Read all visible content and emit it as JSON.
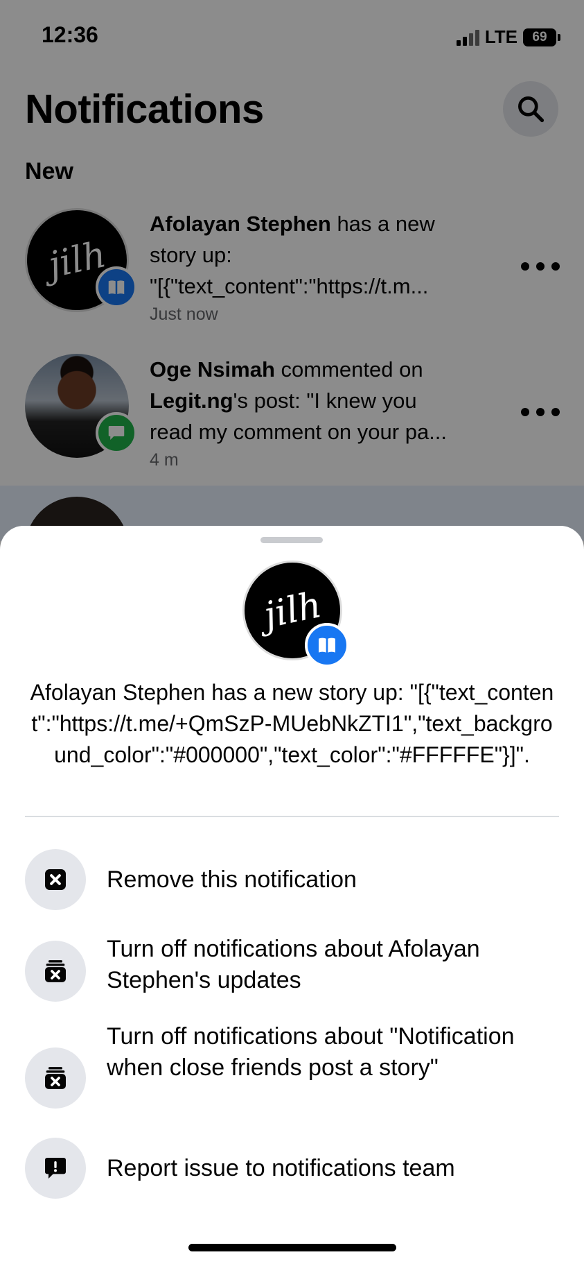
{
  "status_bar": {
    "time": "12:36",
    "network": "LTE",
    "battery": "69"
  },
  "page": {
    "title": "Notifications",
    "section_label": "New"
  },
  "notifications": [
    {
      "actor": "Afolayan Stephen",
      "text_line1_rest": " has a new",
      "text_line2": "story up:",
      "text_line3": "\"[{\"text_content\":\"https://t.m...",
      "time": "Just now",
      "avatar_logo": "jilh",
      "badge_icon": "book-icon"
    },
    {
      "actor": "Oge Nsimah",
      "text_line1_rest": " commented on",
      "page_name": "Legit.ng",
      "text_line2_rest": "'s post: \"I knew you",
      "text_line3": "read my comment on your pa...",
      "time": "4 m",
      "badge_icon": "comment-icon"
    }
  ],
  "sheet": {
    "avatar_logo": "jilh",
    "description": "Afolayan Stephen has a new story up: \"[{\"text_content\":\"https://t.me/+QmSzP-MUebNkZTI1\",\"text_background_color\":\"#000000\",\"text_color\":\"#FFFFFE\"}]\".",
    "actions": [
      {
        "label": "Remove this notification",
        "icon": "close-square-icon"
      },
      {
        "label": "Turn off notifications about Afolayan Stephen's updates",
        "icon": "notification-off-icon"
      },
      {
        "label": "Turn off notifications about \"Notification when close friends post a story\"",
        "icon": "notification-off-icon"
      },
      {
        "label": "Report issue to notifications team",
        "icon": "report-icon"
      }
    ]
  },
  "colors": {
    "accent_blue": "#1877f2",
    "comment_green": "#20b34a",
    "secondary_text": "#65676b",
    "icon_bg": "#e4e6eb"
  }
}
